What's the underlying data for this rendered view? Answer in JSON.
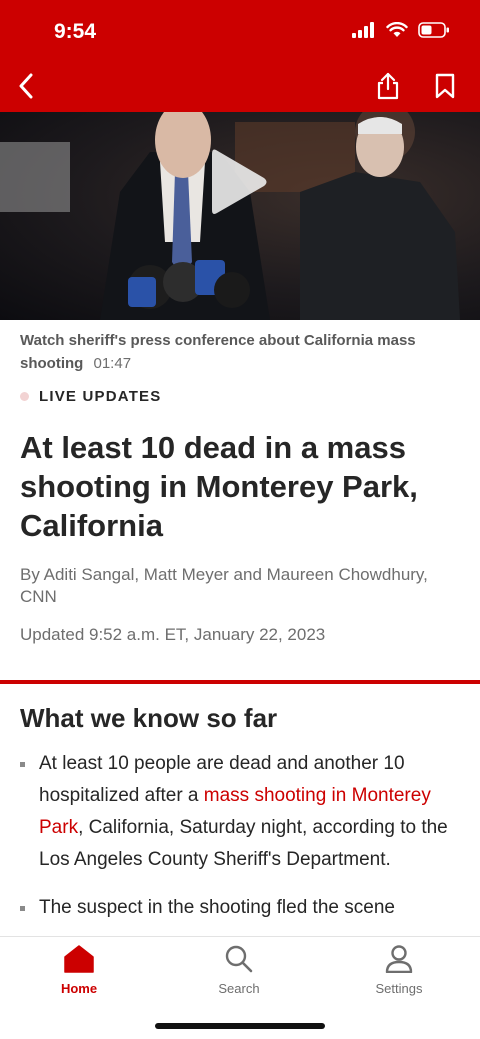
{
  "status_bar": {
    "time": "9:54"
  },
  "video": {
    "caption": "Watch sheriff's press conference about California mass shooting",
    "duration": "01:47"
  },
  "article": {
    "label": "LIVE UPDATES",
    "headline": "At least 10 dead in a mass shooting in Monterey Park, California",
    "byline": "By Aditi Sangal, Matt Meyer and Maureen Chowdhury, CNN",
    "updated": "Updated 9:52 a.m. ET, January 22, 2023"
  },
  "summary": {
    "title": "What we know so far",
    "bullets": [
      {
        "before": "At least 10 people are dead and another 10 hospitalized after a ",
        "link": "mass shooting in Monterey Park",
        "after": ", California, Saturday night, according to the Los Angeles County Sheriff's Department."
      },
      {
        "before": "The suspect in the shooting fled the scene",
        "link": "",
        "after": ""
      }
    ]
  },
  "tabs": [
    {
      "label": "Home",
      "icon": "home-icon",
      "active": true
    },
    {
      "label": "Search",
      "icon": "search-icon",
      "active": false
    },
    {
      "label": "Settings",
      "icon": "person-icon",
      "active": false
    }
  ],
  "colors": {
    "brand": "#cc0000",
    "text": "#262626",
    "muted": "#6e6e6e"
  }
}
